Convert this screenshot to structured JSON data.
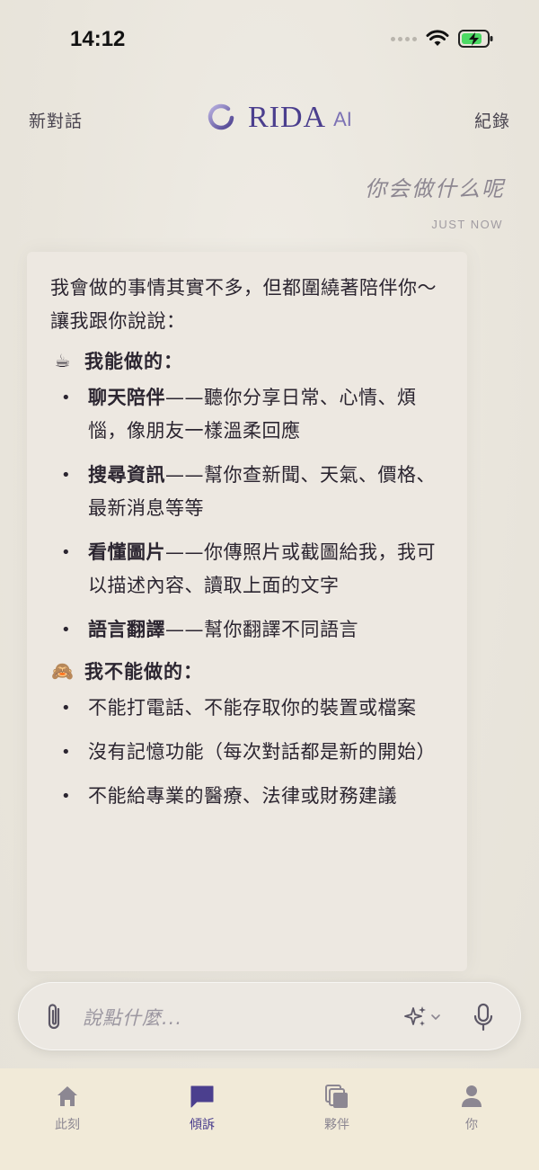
{
  "status_bar": {
    "time": "14:12"
  },
  "header": {
    "new_chat_label": "新對話",
    "brand_name": "RIDA",
    "brand_suffix": "AI",
    "history_label": "紀錄",
    "accent_color": "#4b3f8e"
  },
  "user_message": {
    "text": "你会做什么呢",
    "timestamp": "JUST NOW"
  },
  "assistant_message": {
    "intro": "我會做的事情其實不多，但都圍繞著陪伴你～讓我跟你說說：",
    "can_do": {
      "emoji": "☕",
      "title": "我能做的：",
      "items": [
        {
          "title": "聊天陪伴",
          "text": "——聽你分享日常、心情、煩惱，像朋友一樣溫柔回應"
        },
        {
          "title": "搜尋資訊",
          "text": "——幫你查新聞、天氣、價格、最新消息等等"
        },
        {
          "title": "看懂圖片",
          "text": "——你傳照片或截圖給我，我可以描述內容、讀取上面的文字"
        },
        {
          "title": "語言翻譯",
          "text": "——幫你翻譯不同語言"
        }
      ]
    },
    "cannot_do": {
      "emoji": "🙈",
      "title": "我不能做的：",
      "items": [
        {
          "text": "不能打電話、不能存取你的裝置或檔案"
        },
        {
          "text": "沒有記憶功能（每次對話都是新的開始）"
        },
        {
          "text": "不能給專業的醫療、法律或財務建議"
        }
      ]
    }
  },
  "input": {
    "placeholder": "說點什麼..."
  },
  "tabs": [
    {
      "label": "此刻",
      "icon": "home-icon",
      "active": false
    },
    {
      "label": "傾訴",
      "icon": "chat-icon",
      "active": true
    },
    {
      "label": "夥伴",
      "icon": "cards-icon",
      "active": false
    },
    {
      "label": "你",
      "icon": "person-icon",
      "active": false
    }
  ]
}
